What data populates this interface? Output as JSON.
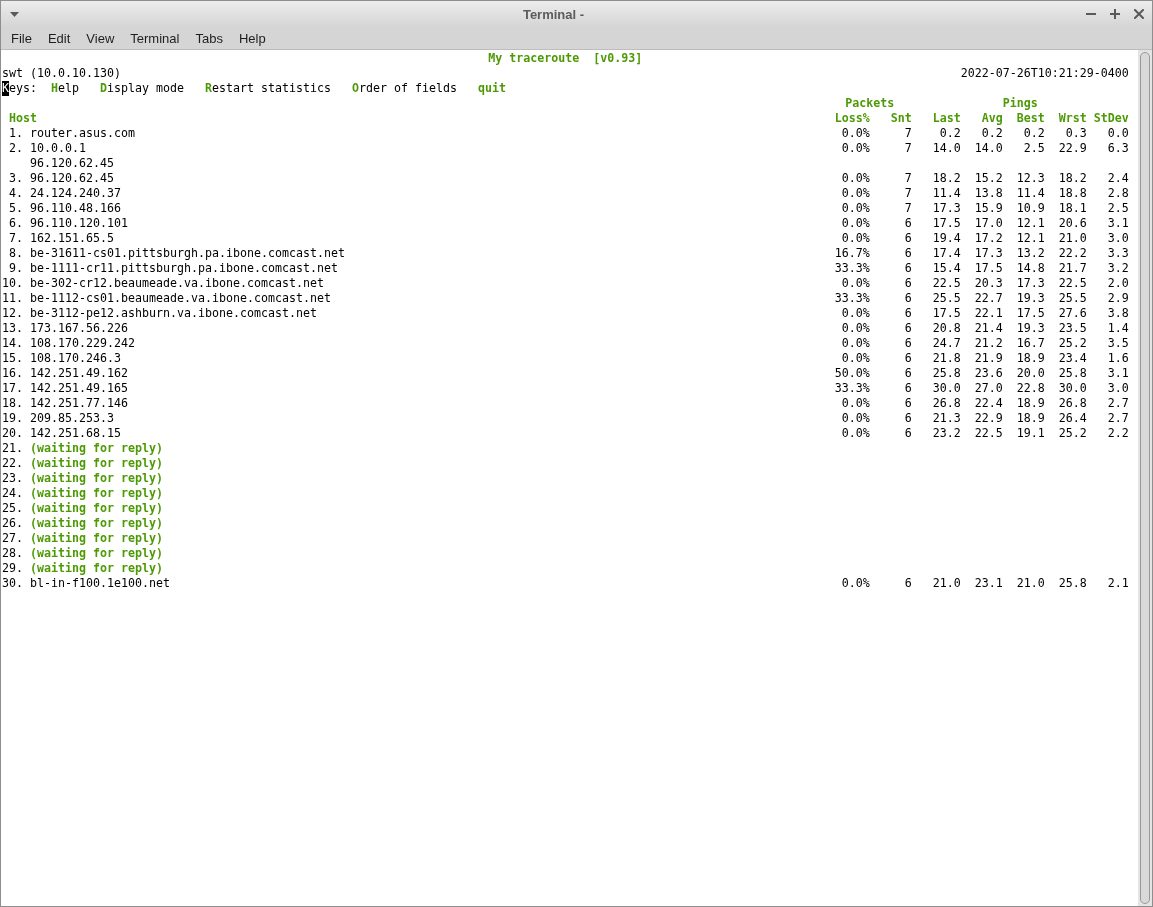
{
  "window": {
    "title": "Terminal -"
  },
  "menu": [
    "File",
    "Edit",
    "View",
    "Terminal",
    "Tabs",
    "Help"
  ],
  "mtr": {
    "title": "My traceroute  [v0.93]",
    "hostname": "swt (10.0.10.130)",
    "timestamp": "2022-07-26T10:21:29-0400",
    "keys": {
      "label": "Keys:",
      "cursor": true,
      "items": [
        {
          "label": "Help",
          "kind": "initial"
        },
        {
          "label": "Display mode",
          "kind": "initial"
        },
        {
          "label": "Restart statistics",
          "kind": "initial"
        },
        {
          "label": "Order of fields",
          "kind": "initial"
        },
        {
          "label": "quit",
          "kind": "whole"
        }
      ]
    },
    "column_groups": [
      "Packets",
      "Pings"
    ],
    "columns": [
      "Host",
      "Loss%",
      "Snt",
      "Last",
      "Avg",
      "Best",
      "Wrst",
      "StDev"
    ],
    "hops": [
      {
        "number": "1.",
        "kind": "reply",
        "host": "router.asus.com",
        "stats": [
          "0.0%",
          "7",
          "0.2",
          "0.2",
          "0.2",
          "0.3",
          "0.0"
        ]
      },
      {
        "number": "2.",
        "kind": "reply",
        "host": "10.0.0.1",
        "stats": [
          "0.0%",
          "7",
          "14.0",
          "14.0",
          "2.5",
          "22.9",
          "6.3"
        ],
        "alternate_hosts": [
          "96.120.62.45"
        ]
      },
      {
        "number": "3.",
        "kind": "reply",
        "host": "96.120.62.45",
        "stats": [
          "0.0%",
          "7",
          "18.2",
          "15.2",
          "12.3",
          "18.2",
          "2.4"
        ]
      },
      {
        "number": "4.",
        "kind": "reply",
        "host": "24.124.240.37",
        "stats": [
          "0.0%",
          "7",
          "11.4",
          "13.8",
          "11.4",
          "18.8",
          "2.8"
        ]
      },
      {
        "number": "5.",
        "kind": "reply",
        "host": "96.110.48.166",
        "stats": [
          "0.0%",
          "7",
          "17.3",
          "15.9",
          "10.9",
          "18.1",
          "2.5"
        ]
      },
      {
        "number": "6.",
        "kind": "reply",
        "host": "96.110.120.101",
        "stats": [
          "0.0%",
          "6",
          "17.5",
          "17.0",
          "12.1",
          "20.6",
          "3.1"
        ]
      },
      {
        "number": "7.",
        "kind": "reply",
        "host": "162.151.65.5",
        "stats": [
          "0.0%",
          "6",
          "19.4",
          "17.2",
          "12.1",
          "21.0",
          "3.0"
        ]
      },
      {
        "number": "8.",
        "kind": "reply",
        "host": "be-31611-cs01.pittsburgh.pa.ibone.comcast.net",
        "stats": [
          "16.7%",
          "6",
          "17.4",
          "17.3",
          "13.2",
          "22.2",
          "3.3"
        ]
      },
      {
        "number": "9.",
        "kind": "reply",
        "host": "be-1111-cr11.pittsburgh.pa.ibone.comcast.net",
        "stats": [
          "33.3%",
          "6",
          "15.4",
          "17.5",
          "14.8",
          "21.7",
          "3.2"
        ]
      },
      {
        "number": "10.",
        "kind": "reply",
        "host": "be-302-cr12.beaumeade.va.ibone.comcast.net",
        "stats": [
          "0.0%",
          "6",
          "22.5",
          "20.3",
          "17.3",
          "22.5",
          "2.0"
        ]
      },
      {
        "number": "11.",
        "kind": "reply",
        "host": "be-1112-cs01.beaumeade.va.ibone.comcast.net",
        "stats": [
          "33.3%",
          "6",
          "25.5",
          "22.7",
          "19.3",
          "25.5",
          "2.9"
        ]
      },
      {
        "number": "12.",
        "kind": "reply",
        "host": "be-3112-pe12.ashburn.va.ibone.comcast.net",
        "stats": [
          "0.0%",
          "6",
          "17.5",
          "22.1",
          "17.5",
          "27.6",
          "3.8"
        ]
      },
      {
        "number": "13.",
        "kind": "reply",
        "host": "173.167.56.226",
        "stats": [
          "0.0%",
          "6",
          "20.8",
          "21.4",
          "19.3",
          "23.5",
          "1.4"
        ]
      },
      {
        "number": "14.",
        "kind": "reply",
        "host": "108.170.229.242",
        "stats": [
          "0.0%",
          "6",
          "24.7",
          "21.2",
          "16.7",
          "25.2",
          "3.5"
        ]
      },
      {
        "number": "15.",
        "kind": "reply",
        "host": "108.170.246.3",
        "stats": [
          "0.0%",
          "6",
          "21.8",
          "21.9",
          "18.9",
          "23.4",
          "1.6"
        ]
      },
      {
        "number": "16.",
        "kind": "reply",
        "host": "142.251.49.162",
        "stats": [
          "50.0%",
          "6",
          "25.8",
          "23.6",
          "20.0",
          "25.8",
          "3.1"
        ]
      },
      {
        "number": "17.",
        "kind": "reply",
        "host": "142.251.49.165",
        "stats": [
          "33.3%",
          "6",
          "30.0",
          "27.0",
          "22.8",
          "30.0",
          "3.0"
        ]
      },
      {
        "number": "18.",
        "kind": "reply",
        "host": "142.251.77.146",
        "stats": [
          "0.0%",
          "6",
          "26.8",
          "22.4",
          "18.9",
          "26.8",
          "2.7"
        ]
      },
      {
        "number": "19.",
        "kind": "reply",
        "host": "209.85.253.3",
        "stats": [
          "0.0%",
          "6",
          "21.3",
          "22.9",
          "18.9",
          "26.4",
          "2.7"
        ]
      },
      {
        "number": "20.",
        "kind": "reply",
        "host": "142.251.68.15",
        "stats": [
          "0.0%",
          "6",
          "23.2",
          "22.5",
          "19.1",
          "25.2",
          "2.2"
        ]
      },
      {
        "number": "21.",
        "kind": "waiting",
        "host": "(waiting for reply)"
      },
      {
        "number": "22.",
        "kind": "waiting",
        "host": "(waiting for reply)"
      },
      {
        "number": "23.",
        "kind": "waiting",
        "host": "(waiting for reply)"
      },
      {
        "number": "24.",
        "kind": "waiting",
        "host": "(waiting for reply)"
      },
      {
        "number": "25.",
        "kind": "waiting",
        "host": "(waiting for reply)"
      },
      {
        "number": "26.",
        "kind": "waiting",
        "host": "(waiting for reply)"
      },
      {
        "number": "27.",
        "kind": "waiting",
        "host": "(waiting for reply)"
      },
      {
        "number": "28.",
        "kind": "waiting",
        "host": "(waiting for reply)"
      },
      {
        "number": "29.",
        "kind": "waiting",
        "host": "(waiting for reply)"
      },
      {
        "number": "30.",
        "kind": "reply",
        "host": "bl-in-f100.1e100.net",
        "stats": [
          "0.0%",
          "6",
          "21.0",
          "23.1",
          "21.0",
          "25.8",
          "2.1"
        ]
      }
    ]
  }
}
